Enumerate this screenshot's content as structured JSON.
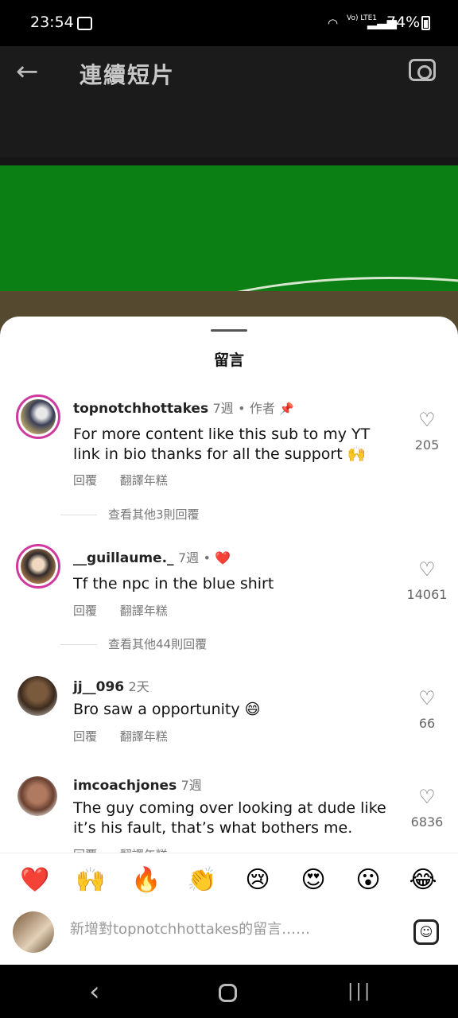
{
  "status_bar": {
    "time": "23:54",
    "volte": "Vo)\nLTE1",
    "battery": "74%"
  },
  "header": {
    "title": "連續短片",
    "back_icon": "back-arrow-icon",
    "camera_icon": "camera-icon"
  },
  "sheet": {
    "title": "留言"
  },
  "comments": [
    {
      "username": "topnotchhottakes",
      "time": "7週",
      "author_label": "作者",
      "text": "For more content like this sub to my YT link in bio thanks for all the support 🙌",
      "reply": "回覆",
      "translate": "翻譯年糕",
      "likes": "205",
      "view_replies": "查看其他3則回覆"
    },
    {
      "username": "__guillaume._",
      "time": "7週",
      "liked_by_author": "❤️",
      "text": "Tf the npc in the blue shirt",
      "reply": "回覆",
      "translate": "翻譯年糕",
      "likes": "14061",
      "view_replies": "查看其他44則回覆"
    },
    {
      "username": "jj__096",
      "time": "2天",
      "text": "Bro saw a opportunity 😄",
      "reply": "回覆",
      "translate": "翻譯年糕",
      "likes": "66"
    },
    {
      "username": "imcoachjones",
      "time": "7週",
      "text": "The guy coming over looking at dude like it’s his fault, that’s what bothers me.",
      "reply": "回覆",
      "translate": "翻譯年糕",
      "likes": "6836"
    }
  ],
  "emoji_bar": [
    "❤️",
    "🙌",
    "🔥",
    "👏",
    "😢",
    "😍",
    "😮",
    "😂"
  ],
  "composer": {
    "placeholder": "新增對topnotchhottakes的留言……"
  },
  "colors": {
    "sheet_bg": "#ffffff",
    "story_ring": "#d03aa0",
    "heart_red": "#e0102a",
    "field_green": "#0c7f14"
  }
}
